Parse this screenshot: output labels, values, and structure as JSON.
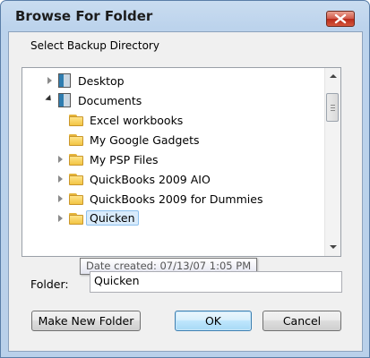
{
  "window": {
    "title": "Browse For Folder"
  },
  "prompt": "Select Backup Directory",
  "tree": {
    "items": [
      {
        "label": "Desktop",
        "icon": "library-icon",
        "expander": "collapsed"
      },
      {
        "label": "Documents",
        "icon": "library-icon",
        "expander": "expanded"
      },
      {
        "label": "Excel workbooks",
        "icon": "folder-icon",
        "expander": "none"
      },
      {
        "label": "My Google Gadgets",
        "icon": "folder-icon",
        "expander": "none"
      },
      {
        "label": "My PSP Files",
        "icon": "folder-icon",
        "expander": "collapsed"
      },
      {
        "label": "QuickBooks 2009 AIO",
        "icon": "folder-icon",
        "expander": "collapsed"
      },
      {
        "label": "QuickBooks 2009 for Dummies",
        "icon": "folder-icon",
        "expander": "collapsed"
      },
      {
        "label": "Quicken",
        "icon": "folder-icon",
        "expander": "collapsed",
        "selected": true
      }
    ]
  },
  "tooltip": "Date created: 07/13/07 1:05 PM",
  "folder": {
    "label": "Folder:",
    "value": "Quicken"
  },
  "buttons": {
    "new_folder": "Make New Folder",
    "ok": "OK",
    "cancel": "Cancel"
  }
}
